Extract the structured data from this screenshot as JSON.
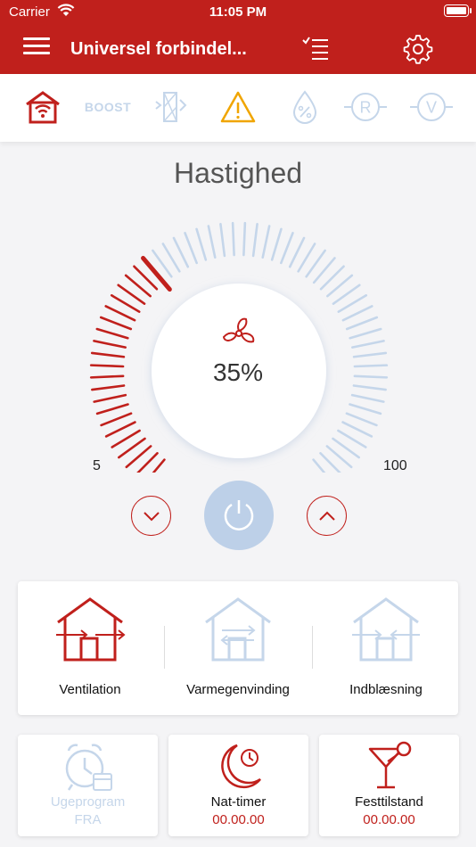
{
  "status_bar": {
    "carrier": "Carrier",
    "time": "11:05 PM"
  },
  "header": {
    "title": "Universel forbindel..."
  },
  "tabs": [
    {
      "name": "home-wifi-icon",
      "active": true
    },
    {
      "name": "boost",
      "label": "BOOST"
    },
    {
      "name": "heat-exchanger-icon"
    },
    {
      "name": "warning-icon",
      "color": "#f0a500"
    },
    {
      "name": "humidity-icon"
    },
    {
      "name": "r-icon"
    },
    {
      "name": "v-icon"
    }
  ],
  "speed": {
    "title": "Hastighed",
    "value_text": "35%",
    "min_label": "5",
    "max_label": "100",
    "level_percent": 35
  },
  "modes": [
    {
      "label": "Ventilation",
      "active": true
    },
    {
      "label": "Varmegenvinding",
      "active": false
    },
    {
      "label": "Indblæsning",
      "active": false
    }
  ],
  "cards": {
    "ugeprogram": {
      "label": "Ugeprogram",
      "value": "FRA",
      "active": false
    },
    "nat_timer": {
      "label": "Nat-timer",
      "value": "00.00.00",
      "active": true
    },
    "festtilstand": {
      "label": "Festtilstand",
      "value": "00.00.00",
      "active": true
    }
  },
  "colors": {
    "brand": "#c0201c",
    "inactive": "#c5d6ea",
    "warning": "#f0a500"
  }
}
